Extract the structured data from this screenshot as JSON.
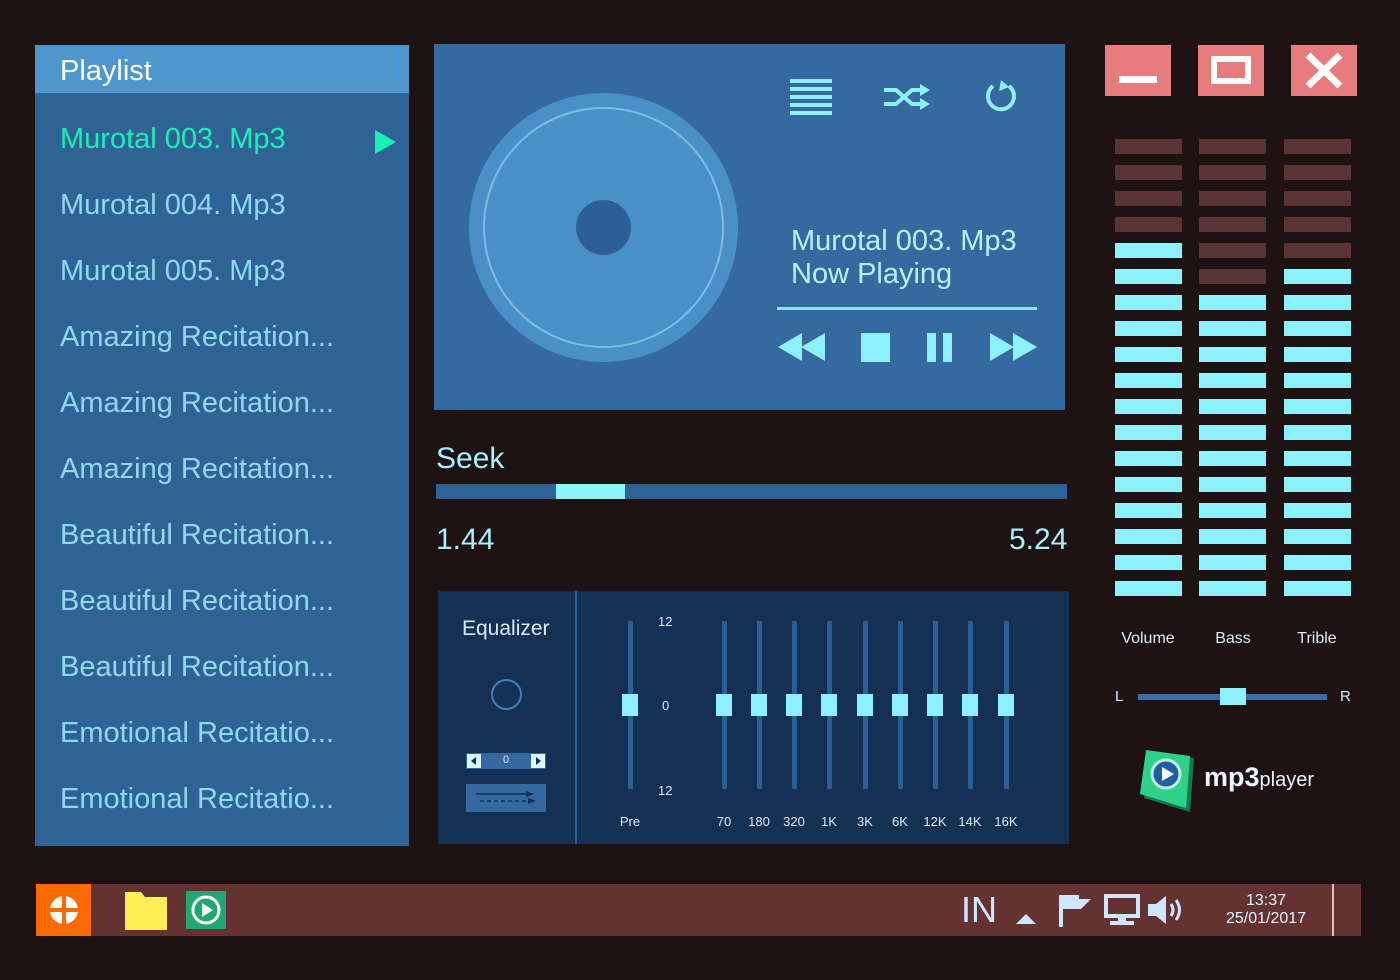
{
  "playlist": {
    "title": "Playlist",
    "items": [
      {
        "label": "Murotal 003. Mp3",
        "active": true
      },
      {
        "label": "Murotal 004. Mp3"
      },
      {
        "label": "Murotal 005. Mp3"
      },
      {
        "label": "Amazing Recitation..."
      },
      {
        "label": "Amazing Recitation..."
      },
      {
        "label": "Amazing Recitation..."
      },
      {
        "label": "Beautiful Recitation..."
      },
      {
        "label": "Beautiful Recitation..."
      },
      {
        "label": "Beautiful Recitation..."
      },
      {
        "label": "Emotional Recitatio..."
      },
      {
        "label": "Emotional Recitatio..."
      }
    ]
  },
  "now_playing": {
    "title": "Murotal 003. Mp3",
    "status": "Now Playing",
    "toolbar_icons": [
      "list-icon",
      "shuffle-icon",
      "repeat-icon"
    ],
    "controls": [
      "rewind-icon",
      "stop-icon",
      "pause-icon",
      "fast-forward-icon"
    ]
  },
  "seek": {
    "label": "Seek",
    "current": "1.44",
    "total": "5.24",
    "window_start_fraction": 0.19,
    "window_end_fraction": 0.3
  },
  "equalizer": {
    "title": "Equalizer",
    "stepper_value": "0",
    "scale_top": "12",
    "scale_mid": "0",
    "scale_bottom": "12",
    "bands": [
      {
        "label": "Pre",
        "value": 0
      },
      {
        "label": "70",
        "value": 0
      },
      {
        "label": "180",
        "value": 0
      },
      {
        "label": "320",
        "value": 0
      },
      {
        "label": "1K",
        "value": 0
      },
      {
        "label": "3K",
        "value": 0
      },
      {
        "label": "6K",
        "value": 0
      },
      {
        "label": "12K",
        "value": 0
      },
      {
        "label": "14K",
        "value": 0
      },
      {
        "label": "16K",
        "value": 0
      }
    ]
  },
  "window_controls": [
    "minimize-icon",
    "maximize-icon",
    "close-icon"
  ],
  "meters": [
    {
      "label": "Volume",
      "lit": 14,
      "total": 18
    },
    {
      "label": "Bass",
      "lit": 12,
      "total": 18
    },
    {
      "label": "Trible",
      "lit": 13,
      "total": 18
    }
  ],
  "balance": {
    "left": "L",
    "right": "R",
    "value": 0.5
  },
  "logo": {
    "main": "mp3",
    "sub": "player"
  },
  "taskbar": {
    "lang": "IN",
    "time": "13:37",
    "date": "25/01/2017",
    "tray_icons": [
      "chevron-up-icon",
      "flag-icon",
      "monitor-icon",
      "speaker-icon"
    ]
  },
  "colors": {
    "background": "#1e1212",
    "panel": "#2f6396",
    "accent": "#8ef0fa",
    "active_track": "#19f0b4",
    "meter_off": "#5a3434",
    "window_button": "#e87b7b",
    "taskbar": "#653232",
    "start": "#ff6a00"
  }
}
